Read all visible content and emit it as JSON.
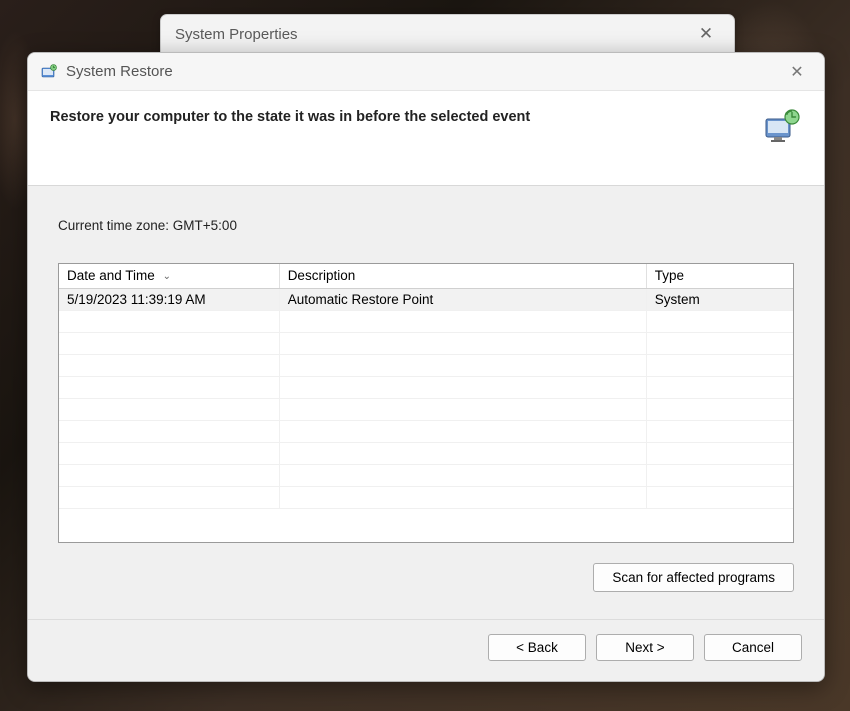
{
  "parentWindow": {
    "title": "System Properties"
  },
  "window": {
    "title": "System Restore"
  },
  "header": {
    "title": "Restore your computer to the state it was in before the selected event"
  },
  "body": {
    "timezone": "Current time zone: GMT+5:00",
    "columns": {
      "date": "Date and Time",
      "description": "Description",
      "type": "Type"
    },
    "rows": [
      {
        "date": "5/19/2023 11:39:19 AM",
        "description": "Automatic Restore Point",
        "type": "System"
      }
    ],
    "scanButton": "Scan for affected programs"
  },
  "footer": {
    "back": "< Back",
    "next": "Next >",
    "cancel": "Cancel"
  }
}
